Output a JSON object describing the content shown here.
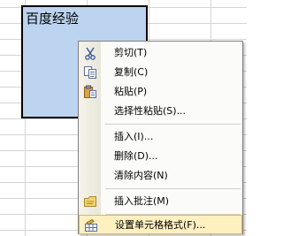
{
  "sheet": {
    "cell_value": "百度经验"
  },
  "context_menu": {
    "items": [
      {
        "label": "剪切(T)",
        "icon": "scissors-icon"
      },
      {
        "label": "复制(C)",
        "icon": "copy-icon"
      },
      {
        "label": "粘贴(P)",
        "icon": "paste-icon"
      },
      {
        "label": "选择性粘贴(S)..."
      },
      {
        "label": "插入(I)..."
      },
      {
        "label": "删除(D)..."
      },
      {
        "label": "清除内容(N)"
      },
      {
        "label": "插入批注(M)",
        "icon": "comment-icon"
      },
      {
        "label": "设置单元格格式(F)...",
        "icon": "format-cells-icon"
      }
    ]
  },
  "colors": {
    "selection_fill": "#bcd4ef",
    "menu_highlight": "#fff0c0",
    "menu_highlight_border": "#e7b84f"
  }
}
